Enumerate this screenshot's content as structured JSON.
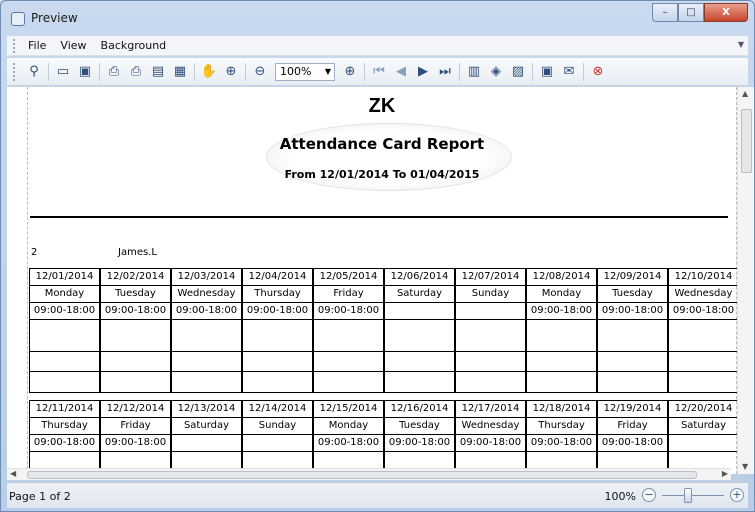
{
  "window": {
    "title": "Preview",
    "buttons": [
      "–",
      "□",
      "X"
    ]
  },
  "menu": [
    "File",
    "View",
    "Background"
  ],
  "toolbar": {
    "zoom_value": "100%",
    "icons": [
      "binoculars-icon",
      "open-folder-icon",
      "save-icon",
      "page-setup-icon",
      "print-icon",
      "print-preview-icon",
      "export-icon",
      "hand-tool-icon",
      "magnifier-icon",
      "zoom-out-icon",
      "zoom-in-icon",
      "first-page-icon",
      "prev-page-icon",
      "next-page-icon",
      "last-page-icon",
      "multiple-pages-icon",
      "color-icon",
      "watermark-icon",
      "export-document-icon",
      "send-email-icon",
      "close-preview-icon"
    ]
  },
  "report": {
    "company": "ZK",
    "title": "Attendance Card Report",
    "range": "From 12/01/2014 To 01/04/2015",
    "employee_id": "2",
    "employee_name": "James.L"
  },
  "week1": [
    {
      "date": "12/01/2014",
      "day": "Monday",
      "shift": "09:00-18:00"
    },
    {
      "date": "12/02/2014",
      "day": "Tuesday",
      "shift": "09:00-18:00"
    },
    {
      "date": "12/03/2014",
      "day": "Wednesday",
      "shift": "09:00-18:00"
    },
    {
      "date": "12/04/2014",
      "day": "Thursday",
      "shift": "09:00-18:00"
    },
    {
      "date": "12/05/2014",
      "day": "Friday",
      "shift": "09:00-18:00"
    },
    {
      "date": "12/06/2014",
      "day": "Saturday",
      "shift": ""
    },
    {
      "date": "12/07/2014",
      "day": "Sunday",
      "shift": ""
    },
    {
      "date": "12/08/2014",
      "day": "Monday",
      "shift": "09:00-18:00"
    },
    {
      "date": "12/09/2014",
      "day": "Tuesday",
      "shift": "09:00-18:00"
    },
    {
      "date": "12/10/2014",
      "day": "Wednesday",
      "shift": "09:00-18:00"
    }
  ],
  "week2": [
    {
      "date": "12/11/2014",
      "day": "Thursday",
      "shift": "09:00-18:00"
    },
    {
      "date": "12/12/2014",
      "day": "Friday",
      "shift": "09:00-18:00"
    },
    {
      "date": "12/13/2014",
      "day": "Saturday",
      "shift": ""
    },
    {
      "date": "12/14/2014",
      "day": "Sunday",
      "shift": ""
    },
    {
      "date": "12/15/2014",
      "day": "Monday",
      "shift": "09:00-18:00"
    },
    {
      "date": "12/16/2014",
      "day": "Tuesday",
      "shift": "09:00-18:00"
    },
    {
      "date": "12/17/2014",
      "day": "Wednesday",
      "shift": "09:00-18:00"
    },
    {
      "date": "12/18/2014",
      "day": "Thursday",
      "shift": "09:00-18:00"
    },
    {
      "date": "12/19/2014",
      "day": "Friday",
      "shift": "09:00-18:00"
    },
    {
      "date": "12/20/2014",
      "day": "Saturday",
      "shift": ""
    }
  ],
  "status": {
    "page_info": "Page 1 of 2",
    "zoom": "100%",
    "zoom_minus": "−",
    "zoom_plus": "+"
  }
}
